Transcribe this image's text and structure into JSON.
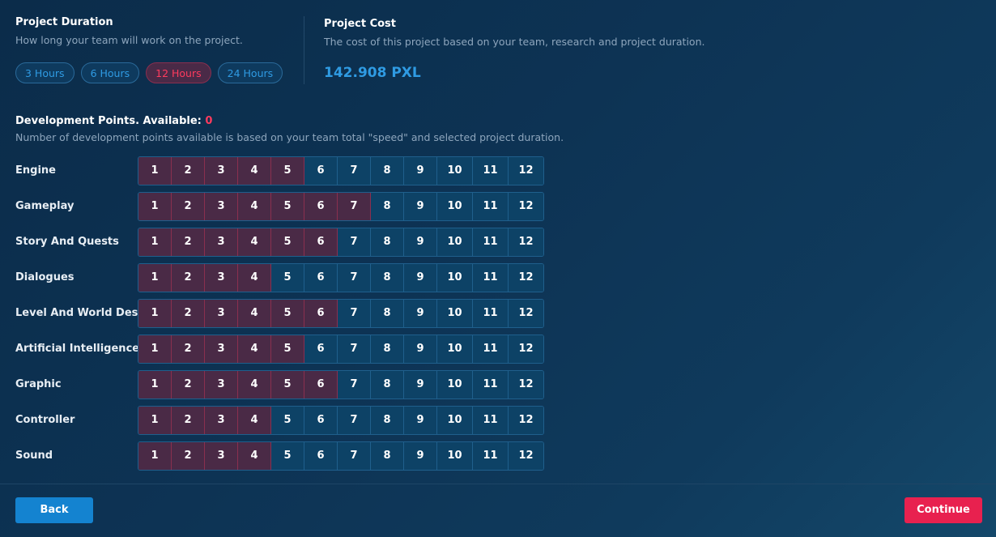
{
  "duration": {
    "title": "Project Duration",
    "subtitle": "How long your team will work on the project.",
    "options": [
      {
        "label": "3 Hours",
        "active": false
      },
      {
        "label": "6 Hours",
        "active": false
      },
      {
        "label": "12 Hours",
        "active": true
      },
      {
        "label": "24 Hours",
        "active": false
      }
    ]
  },
  "cost": {
    "title": "Project Cost",
    "subtitle": "The cost of this project based on your team, research and project duration.",
    "value": "142.908 PXL"
  },
  "dev_points": {
    "title": "Development Points. Available: ",
    "available": "0",
    "subtitle": "Number of development points available is based on your team total \"speed\" and selected project duration."
  },
  "levels": [
    "1",
    "2",
    "3",
    "4",
    "5",
    "6",
    "7",
    "8",
    "9",
    "10",
    "11",
    "12"
  ],
  "categories": [
    {
      "label": "Engine",
      "selected": 5
    },
    {
      "label": "Gameplay",
      "selected": 7
    },
    {
      "label": "Story And Quests",
      "selected": 6
    },
    {
      "label": "Dialogues",
      "selected": 4
    },
    {
      "label": "Level And World Design",
      "selected": 6
    },
    {
      "label": "Artificial Intelligence",
      "selected": 5
    },
    {
      "label": "Graphic",
      "selected": 6
    },
    {
      "label": "Controller",
      "selected": 4
    },
    {
      "label": "Sound",
      "selected": 4
    }
  ],
  "footer": {
    "back_label": "Back",
    "continue_label": "Continue"
  },
  "colors": {
    "accent_blue": "#2f9be3",
    "accent_red": "#ff3b5e",
    "back_button": "#1483d0",
    "continue_button": "#e8214f",
    "selected_cell": "#4a2a46",
    "unselected_cell": "#0d4266"
  }
}
